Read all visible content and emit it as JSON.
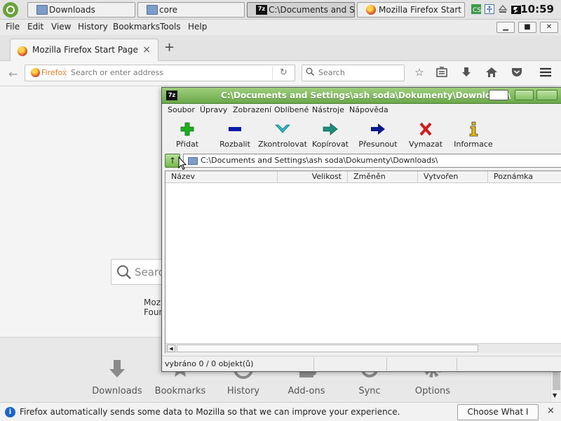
{
  "taskbar": {
    "tasks": [
      {
        "label": "Downloads",
        "icon": "folder-icon"
      },
      {
        "label": "core",
        "icon": "folder-icon"
      },
      {
        "label": "C:\\Documents and S...",
        "icon": "7zip-icon",
        "active": true
      },
      {
        "label": "Mozilla Firefox Start ...",
        "icon": "firefox-icon"
      }
    ],
    "clock": "10:59"
  },
  "firefox": {
    "menu": [
      "File",
      "Edit",
      "View",
      "History",
      "Bookmarks",
      "Tools",
      "Help"
    ],
    "tab_title": "Mozilla Firefox Start Page",
    "tab_close": "×",
    "new_tab": "+",
    "url_badge": "Firefox",
    "url_placeholder": "Search or enter address",
    "search_placeholder": "Search",
    "page": {
      "search_placeholder": "Searc",
      "footer_line1": "Mozil",
      "footer_line2": "Foun"
    },
    "launchers": [
      "Downloads",
      "Bookmarks",
      "History",
      "Add-ons",
      "Sync",
      "Options"
    ],
    "notification": {
      "text": "Firefox automatically sends some data to Mozilla so that we can improve your experience.",
      "button": "Choose What I Share",
      "close": "×"
    }
  },
  "sevenzip": {
    "title": "C:\\Documents and Settings\\ash soda\\Dokumenty\\Downloads\\",
    "logo": "7z",
    "menu": [
      "Soubor",
      "Úpravy",
      "Zobrazení",
      "Oblíbené",
      "Nástroje",
      "Nápověda"
    ],
    "toolbar": [
      {
        "label": "Přidat",
        "icon": "plus-icon",
        "color": "#1fae1f"
      },
      {
        "label": "Rozbalit",
        "icon": "minus-icon",
        "color": "#0a1aa8"
      },
      {
        "label": "Zkontrolovat",
        "icon": "check-icon",
        "color": "#2ab8c8"
      },
      {
        "label": "Kopírovat",
        "icon": "copy-arrow-icon",
        "color": "#1b8e7a"
      },
      {
        "label": "Přesunout",
        "icon": "move-arrow-icon",
        "color": "#0a1a8c"
      },
      {
        "label": "Vymazat",
        "icon": "delete-x-icon",
        "color": "#d21b1b"
      },
      {
        "label": "Informace",
        "icon": "info-icon",
        "color": "#e6b800"
      }
    ],
    "path": "C:\\Documents and Settings\\ash soda\\Dokumenty\\Downloads\\",
    "columns": [
      "Název",
      "Velikost",
      "Změněn",
      "Vytvořen",
      "Poznámka"
    ],
    "status": "vybráno 0 / 0 objekt(ů)"
  }
}
